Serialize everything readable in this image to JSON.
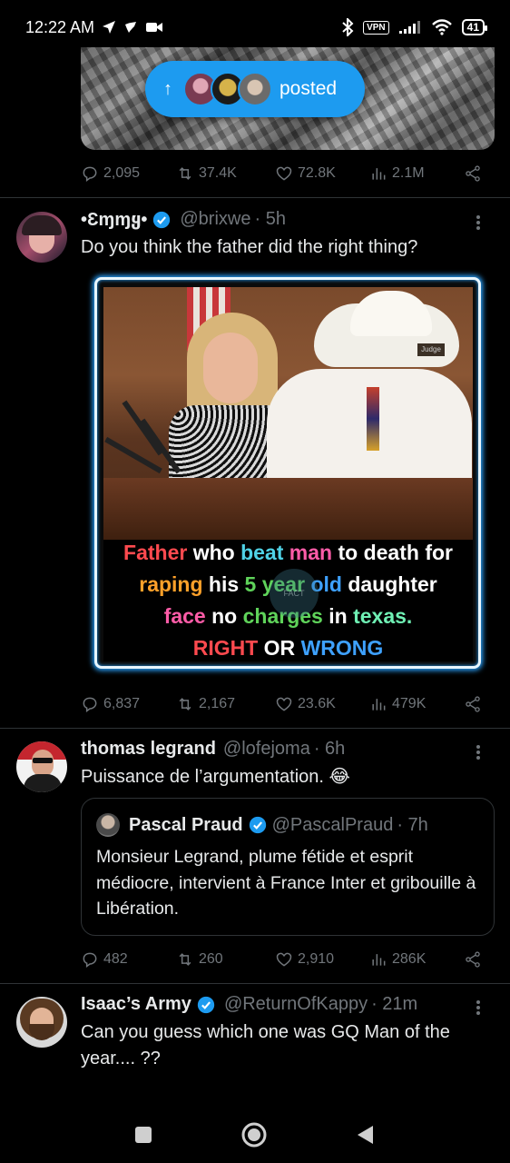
{
  "status_bar": {
    "time": "12:22 AM",
    "vpn": "VPN",
    "battery": "41"
  },
  "top_post": {
    "posted_pill": {
      "arrow": "↑",
      "label": "posted"
    },
    "actions": {
      "replies": "2,095",
      "reposts": "37.4K",
      "likes": "72.8K",
      "views": "2.1M"
    }
  },
  "tweets": [
    {
      "name": "•Ɛɱɱყ•",
      "handle": "@brixwe",
      "time": "· 5h",
      "text": "Do you think the father did the right thing?",
      "media_caption": {
        "line1": [
          "Father",
          "who",
          "beat",
          "man",
          "to death",
          "for"
        ],
        "line2": [
          "raping",
          "his",
          "5 year",
          "old",
          "daughter"
        ],
        "line3": [
          "face",
          "no",
          "charges",
          "in",
          "texas."
        ],
        "line4": [
          "RIGHT",
          "OR",
          "WRONG"
        ],
        "sign": "Judge",
        "watermark": "FACT"
      },
      "actions": {
        "replies": "6,837",
        "reposts": "2,167",
        "likes": "23.6K",
        "views": "479K"
      }
    },
    {
      "name": "thomas legrand",
      "handle": "@lofejoma",
      "time": "· 6h",
      "text": "Puissance de l’argumentation. 😂",
      "quote": {
        "name": "Pascal Praud",
        "handle": "@PascalPraud",
        "time": "· 7h",
        "text": "Monsieur Legrand, plume fétide et esprit médiocre, intervient à France Inter et gribouille à Libération."
      },
      "actions": {
        "replies": "482",
        "reposts": "260",
        "likes": "2,910",
        "views": "286K"
      }
    },
    {
      "name": "Isaac’s Army",
      "handle": "@ReturnOfKappy",
      "time": "· 21m",
      "text": "Can you guess which one was GQ Man of the year.... ??"
    }
  ],
  "colors": {
    "accent": "#1d9bf0",
    "muted": "#71767b",
    "divider": "#2f3336",
    "background": "#000000"
  },
  "icons": [
    "location-arrow-icon",
    "notification-icon",
    "video-icon",
    "bluetooth-icon",
    "signal-icon",
    "wifi-icon",
    "reply-icon",
    "repost-icon",
    "like-icon",
    "views-icon",
    "share-icon",
    "verified-icon",
    "more-icon",
    "recents-icon",
    "home-icon",
    "back-icon"
  ]
}
